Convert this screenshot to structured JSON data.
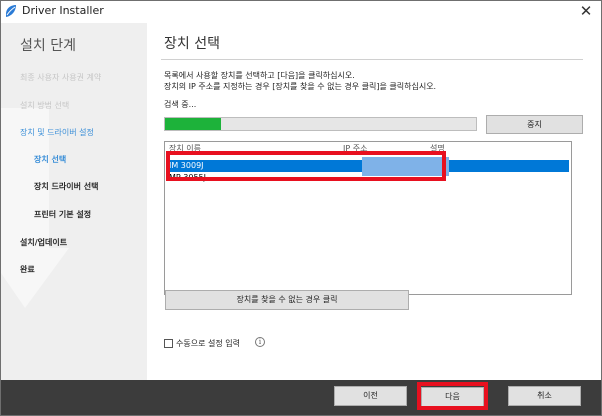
{
  "window": {
    "title": "Driver Installer",
    "close_glyph": "✕"
  },
  "sidebar": {
    "title": "설치 단계",
    "items": [
      {
        "label": "최종 사용자 사용권 계약",
        "state": "done"
      },
      {
        "label": "설치 방법 선택",
        "state": "done"
      },
      {
        "label": "장치 및 드라이버 설정",
        "state": "active-parent"
      },
      {
        "label": "장치 선택",
        "state": "active"
      },
      {
        "label": "장치 드라이버 선택",
        "state": "pending"
      },
      {
        "label": "프린터 기본 설정",
        "state": "pending"
      },
      {
        "label": "설치/업데이트",
        "state": "pending"
      },
      {
        "label": "완료",
        "state": "pending"
      }
    ]
  },
  "main": {
    "title": "장치 선택",
    "instruction_line1": "목록에서 사용할 장치를 선택하고 [다음]을 클릭하십시오.",
    "instruction_line2": "장치의 IP 주소를 지정하는 경우 [장치를 찾을 수 없는 경우 클릭]을 클릭하십시오.",
    "status": "검색 중...",
    "progress_percent": 18,
    "stop_label": "중지",
    "columns": [
      "장치 이름",
      "IP 주소",
      "설명"
    ],
    "rows": [
      {
        "name": "IM 3009J",
        "ip": "",
        "desc": "",
        "selected": true
      },
      {
        "name": "MP 3055J",
        "ip": "",
        "desc": "",
        "selected": false
      }
    ],
    "find_label": "장치를 찾을 수 없는 경우 클릭",
    "manual_label": "수동으로 설정 입력",
    "manual_checked": false,
    "info_glyph": "i"
  },
  "footer": {
    "prev_label": "이전",
    "next_label": "다음",
    "cancel_label": "취소"
  },
  "colors": {
    "selection": "#0078d7",
    "progress": "#1db23a",
    "highlight": "#e8101f",
    "active_step": "#3b8fd8",
    "footer_bg": "#3c3c3c"
  }
}
